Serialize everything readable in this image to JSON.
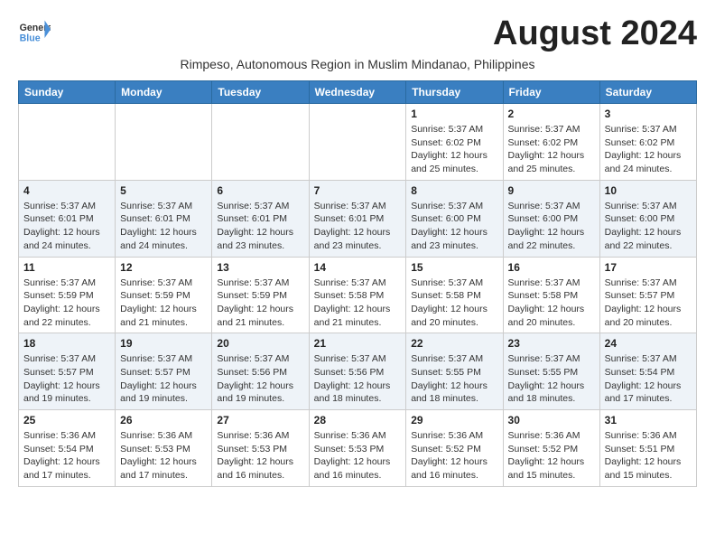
{
  "header": {
    "logo_line1": "General",
    "logo_line2": "Blue",
    "month_year": "August 2024",
    "subtitle": "Rimpeso, Autonomous Region in Muslim Mindanao, Philippines"
  },
  "days_of_week": [
    "Sunday",
    "Monday",
    "Tuesday",
    "Wednesday",
    "Thursday",
    "Friday",
    "Saturday"
  ],
  "weeks": [
    [
      {
        "day": "",
        "info": ""
      },
      {
        "day": "",
        "info": ""
      },
      {
        "day": "",
        "info": ""
      },
      {
        "day": "",
        "info": ""
      },
      {
        "day": "1",
        "info": "Sunrise: 5:37 AM\nSunset: 6:02 PM\nDaylight: 12 hours and 25 minutes."
      },
      {
        "day": "2",
        "info": "Sunrise: 5:37 AM\nSunset: 6:02 PM\nDaylight: 12 hours and 25 minutes."
      },
      {
        "day": "3",
        "info": "Sunrise: 5:37 AM\nSunset: 6:02 PM\nDaylight: 12 hours and 24 minutes."
      }
    ],
    [
      {
        "day": "4",
        "info": "Sunrise: 5:37 AM\nSunset: 6:01 PM\nDaylight: 12 hours and 24 minutes."
      },
      {
        "day": "5",
        "info": "Sunrise: 5:37 AM\nSunset: 6:01 PM\nDaylight: 12 hours and 24 minutes."
      },
      {
        "day": "6",
        "info": "Sunrise: 5:37 AM\nSunset: 6:01 PM\nDaylight: 12 hours and 23 minutes."
      },
      {
        "day": "7",
        "info": "Sunrise: 5:37 AM\nSunset: 6:01 PM\nDaylight: 12 hours and 23 minutes."
      },
      {
        "day": "8",
        "info": "Sunrise: 5:37 AM\nSunset: 6:00 PM\nDaylight: 12 hours and 23 minutes."
      },
      {
        "day": "9",
        "info": "Sunrise: 5:37 AM\nSunset: 6:00 PM\nDaylight: 12 hours and 22 minutes."
      },
      {
        "day": "10",
        "info": "Sunrise: 5:37 AM\nSunset: 6:00 PM\nDaylight: 12 hours and 22 minutes."
      }
    ],
    [
      {
        "day": "11",
        "info": "Sunrise: 5:37 AM\nSunset: 5:59 PM\nDaylight: 12 hours and 22 minutes."
      },
      {
        "day": "12",
        "info": "Sunrise: 5:37 AM\nSunset: 5:59 PM\nDaylight: 12 hours and 21 minutes."
      },
      {
        "day": "13",
        "info": "Sunrise: 5:37 AM\nSunset: 5:59 PM\nDaylight: 12 hours and 21 minutes."
      },
      {
        "day": "14",
        "info": "Sunrise: 5:37 AM\nSunset: 5:58 PM\nDaylight: 12 hours and 21 minutes."
      },
      {
        "day": "15",
        "info": "Sunrise: 5:37 AM\nSunset: 5:58 PM\nDaylight: 12 hours and 20 minutes."
      },
      {
        "day": "16",
        "info": "Sunrise: 5:37 AM\nSunset: 5:58 PM\nDaylight: 12 hours and 20 minutes."
      },
      {
        "day": "17",
        "info": "Sunrise: 5:37 AM\nSunset: 5:57 PM\nDaylight: 12 hours and 20 minutes."
      }
    ],
    [
      {
        "day": "18",
        "info": "Sunrise: 5:37 AM\nSunset: 5:57 PM\nDaylight: 12 hours and 19 minutes."
      },
      {
        "day": "19",
        "info": "Sunrise: 5:37 AM\nSunset: 5:57 PM\nDaylight: 12 hours and 19 minutes."
      },
      {
        "day": "20",
        "info": "Sunrise: 5:37 AM\nSunset: 5:56 PM\nDaylight: 12 hours and 19 minutes."
      },
      {
        "day": "21",
        "info": "Sunrise: 5:37 AM\nSunset: 5:56 PM\nDaylight: 12 hours and 18 minutes."
      },
      {
        "day": "22",
        "info": "Sunrise: 5:37 AM\nSunset: 5:55 PM\nDaylight: 12 hours and 18 minutes."
      },
      {
        "day": "23",
        "info": "Sunrise: 5:37 AM\nSunset: 5:55 PM\nDaylight: 12 hours and 18 minutes."
      },
      {
        "day": "24",
        "info": "Sunrise: 5:37 AM\nSunset: 5:54 PM\nDaylight: 12 hours and 17 minutes."
      }
    ],
    [
      {
        "day": "25",
        "info": "Sunrise: 5:36 AM\nSunset: 5:54 PM\nDaylight: 12 hours and 17 minutes."
      },
      {
        "day": "26",
        "info": "Sunrise: 5:36 AM\nSunset: 5:53 PM\nDaylight: 12 hours and 17 minutes."
      },
      {
        "day": "27",
        "info": "Sunrise: 5:36 AM\nSunset: 5:53 PM\nDaylight: 12 hours and 16 minutes."
      },
      {
        "day": "28",
        "info": "Sunrise: 5:36 AM\nSunset: 5:53 PM\nDaylight: 12 hours and 16 minutes."
      },
      {
        "day": "29",
        "info": "Sunrise: 5:36 AM\nSunset: 5:52 PM\nDaylight: 12 hours and 16 minutes."
      },
      {
        "day": "30",
        "info": "Sunrise: 5:36 AM\nSunset: 5:52 PM\nDaylight: 12 hours and 15 minutes."
      },
      {
        "day": "31",
        "info": "Sunrise: 5:36 AM\nSunset: 5:51 PM\nDaylight: 12 hours and 15 minutes."
      }
    ]
  ]
}
